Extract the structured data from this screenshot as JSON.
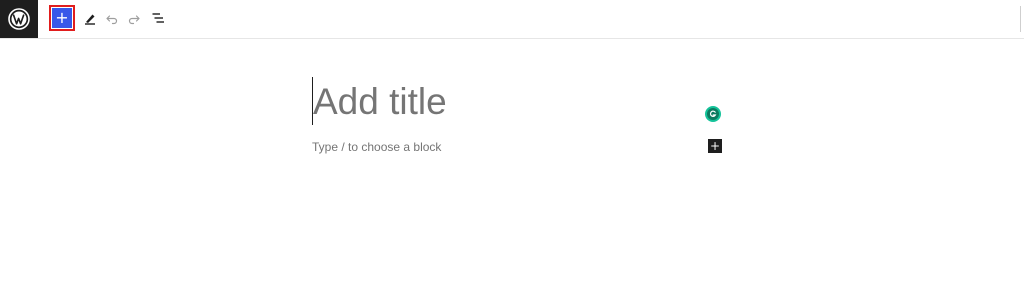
{
  "toolbar": {
    "add_block_label": "+",
    "icons": {
      "logo": "wordpress-icon",
      "add": "plus-icon",
      "tools": "pencil-icon",
      "undo": "undo-icon",
      "redo": "redo-icon",
      "outline": "list-view-icon"
    },
    "colors": {
      "logo_bg": "#1e1e1e",
      "add_bg": "#3858e9",
      "highlight": "#e11d1d"
    }
  },
  "editor": {
    "title_placeholder": "Add title",
    "block_placeholder": "Type / to choose a block",
    "inline_add_label": "+",
    "grammarly_icon": "grammarly-icon"
  }
}
